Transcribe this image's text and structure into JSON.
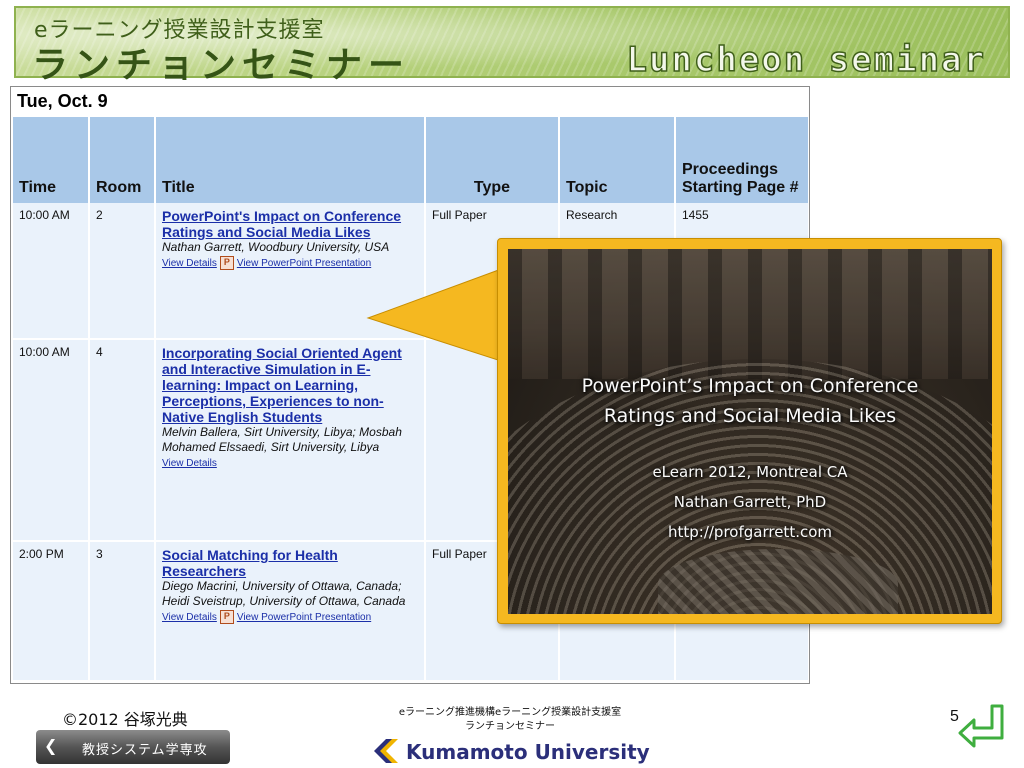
{
  "banner": {
    "jp_line1": "eラーニング授業設計支援室",
    "jp_line2": "ランチョンセミナー",
    "en_title": "Luncheon seminar"
  },
  "schedule": {
    "date": "Tue, Oct. 9",
    "columns": [
      "Time",
      "Room",
      "Title",
      "Type",
      "Topic",
      "Proceedings Starting Page #"
    ],
    "rows": [
      {
        "time": "10:00 AM",
        "room": "2",
        "title": "PowerPoint's Impact on Conference Ratings and Social Media Likes",
        "authors": "Nathan Garrett, Woodbury University, USA",
        "link1": "View Details",
        "link2": "View PowerPoint Presentation",
        "type": "Full Paper",
        "topic": "Research",
        "page": "1455"
      },
      {
        "time": "10:00 AM",
        "room": "4",
        "title": "Incorporating Social Oriented Agent and Interactive Simulation in E-learning: Impact on Learning, Perceptions, Experiences to non-Native English Students",
        "authors": "Melvin Ballera, Sirt University, Libya; Mosbah Mohamed Elssaedi, Sirt University, Libya",
        "link1": "View Details",
        "type": "",
        "topic": "",
        "page": ""
      },
      {
        "time": "2:00 PM",
        "room": "3",
        "title": "Social Matching for Health Researchers",
        "authors": "Diego Macrini, University of Ottawa, Canada; Heidi Sveistrup, University of Ottawa, Canada",
        "link1": "View Details",
        "link2": "View PowerPoint Presentation",
        "type": "Full Paper",
        "topic": "",
        "page": ""
      }
    ]
  },
  "callout": {
    "title_line1": "PowerPoint’s Impact on Conference",
    "title_line2": "Ratings and Social Media Likes",
    "sub_line1": "eLearn 2012, Montreal CA",
    "sub_line2": "Nathan Garrett, PhD",
    "sub_line3": "http://profgarrett.com"
  },
  "footer": {
    "copyright": "©2012 谷塚光典",
    "department": "教授システム学専攻",
    "center_line1": "eラーニング推進機構eラーニング授業設計支援室",
    "center_line2": "ランチョンセミナー",
    "university": "Kumamoto University",
    "page_number": "5"
  },
  "colors": {
    "banner_green": "#a9c96c",
    "table_header": "#a9c8e8",
    "table_cell": "#eaf2fb",
    "link_blue": "#1b2fa8",
    "callout_gold": "#f5b820",
    "return_green": "#3fae3f"
  }
}
